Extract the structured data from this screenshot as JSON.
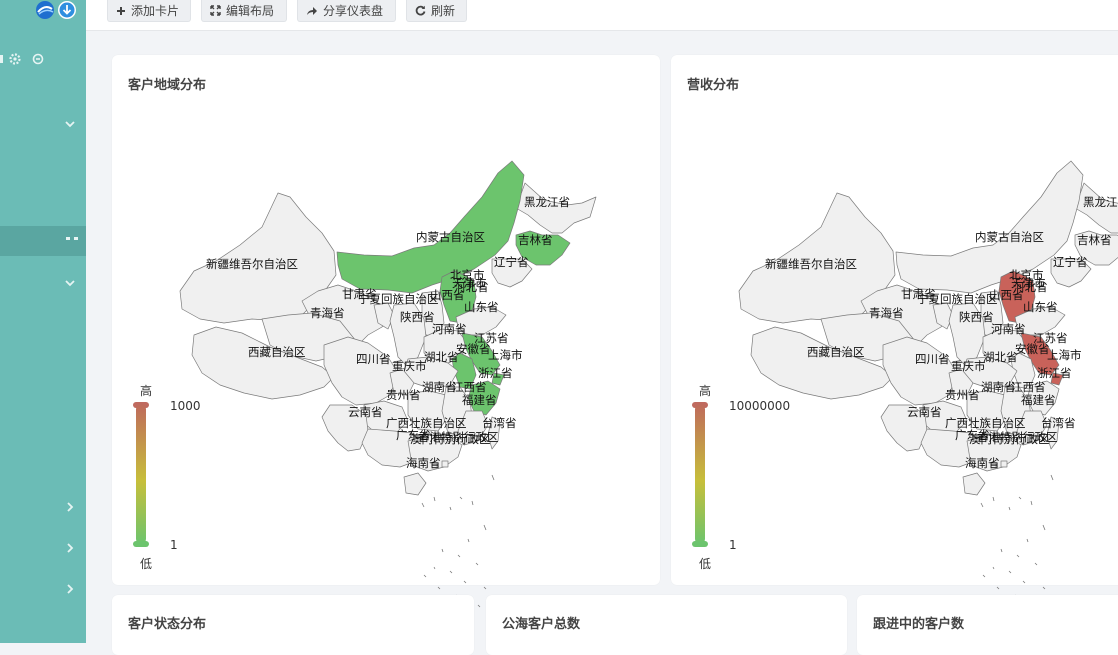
{
  "toolbar": {
    "add_card": "添加卡片",
    "edit_layout": "编辑布局",
    "share_dashboard": "分享仪表盘",
    "refresh": "刷新"
  },
  "cards": {
    "customer_region": {
      "title": "客户地域分布",
      "legend_high": "高",
      "legend_low": "低",
      "legend_max": "1000",
      "legend_min": "1",
      "highlighted": [
        "内蒙古自治区",
        "吉林省",
        "河北省",
        "天津市",
        "北京市",
        "江苏省",
        "浙江省",
        "上海市",
        "安徽省"
      ]
    },
    "revenue": {
      "title": "营收分布",
      "legend_high": "高",
      "legend_low": "低",
      "legend_max": "10000000",
      "legend_min": "1",
      "highlighted": [
        "河北省",
        "北京市",
        "天津市",
        "江苏省",
        "上海市"
      ]
    },
    "customer_status": {
      "title": "客户状态分布"
    },
    "public_pool": {
      "title": "公海客户总数"
    },
    "following": {
      "title": "跟进中的客户数"
    }
  },
  "provinces": [
    "黑龙江省",
    "吉林省",
    "内蒙古自治区",
    "辽宁省",
    "新疆维吾尔自治区",
    "北京市",
    "天津市",
    "甘肃省",
    "宁夏回族自治区",
    "山西省",
    "河北省",
    "青海省",
    "陕西省",
    "山东省",
    "河南省",
    "江苏省",
    "安徽省",
    "上海市",
    "西藏自治区",
    "四川省",
    "重庆市",
    "湖北省",
    "浙江省",
    "湖南省",
    "江西省",
    "贵州省",
    "福建省",
    "云南省",
    "广西壮族自治区",
    "广东省",
    "台湾省",
    "香港特别行政区",
    "澳门特别行政区",
    "海南省"
  ],
  "colors": {
    "sidebar": "#6bbcb6",
    "map_default": "#f0f0f0",
    "green_high": "#6cc46d",
    "red_high": "#c9625a",
    "gradient_top": "#bf6a5c",
    "gradient_mid": "#c7bf3b",
    "gradient_bottom": "#6cc46d"
  }
}
